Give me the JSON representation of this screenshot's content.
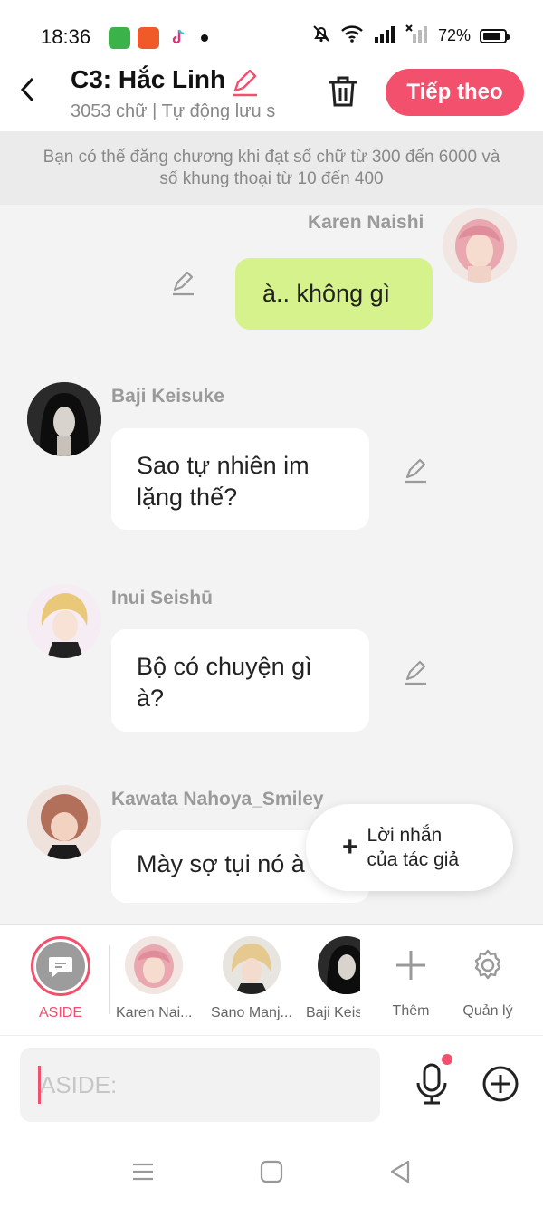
{
  "status_bar": {
    "time": "18:36",
    "battery": "72%",
    "battery_level": 0.72
  },
  "header": {
    "title": "C3: Hắc Linh",
    "subtitle": "3053 chữ | Tự động lưu s",
    "next_label": "Tiếp theo"
  },
  "notice": "Bạn có thể đăng chương khi đạt số chữ từ 300 đến 6000 và số khung thoại từ 10 đến 400",
  "messages": [
    {
      "name": "Karen Naishi",
      "text": "à.. không gì",
      "side": "right"
    },
    {
      "name": "Baji Keisuke",
      "text": "Sao tự nhiên im lặng thế?",
      "side": "left"
    },
    {
      "name": "Inui Seishū",
      "text": "Bộ có chuyện gì à?",
      "side": "left"
    },
    {
      "name": "Kawata Nahoya_Smiley",
      "text": "Mày sợ tụi nó à",
      "side": "left"
    }
  ],
  "author_note": {
    "line1": "Lời nhắn",
    "line2": "của tác giả"
  },
  "characters": [
    {
      "label": "ASIDE"
    },
    {
      "label": "Karen Nai..."
    },
    {
      "label": "Sano Manj..."
    },
    {
      "label": "Baji Keis"
    },
    {
      "label": "Thêm"
    },
    {
      "label": "Quản lý"
    }
  ],
  "input": {
    "placeholder": "ASIDE:"
  },
  "colors": {
    "accent": "#f2506c",
    "my_bubble": "#d5f28c",
    "chat_bg": "#f3f3f3"
  }
}
